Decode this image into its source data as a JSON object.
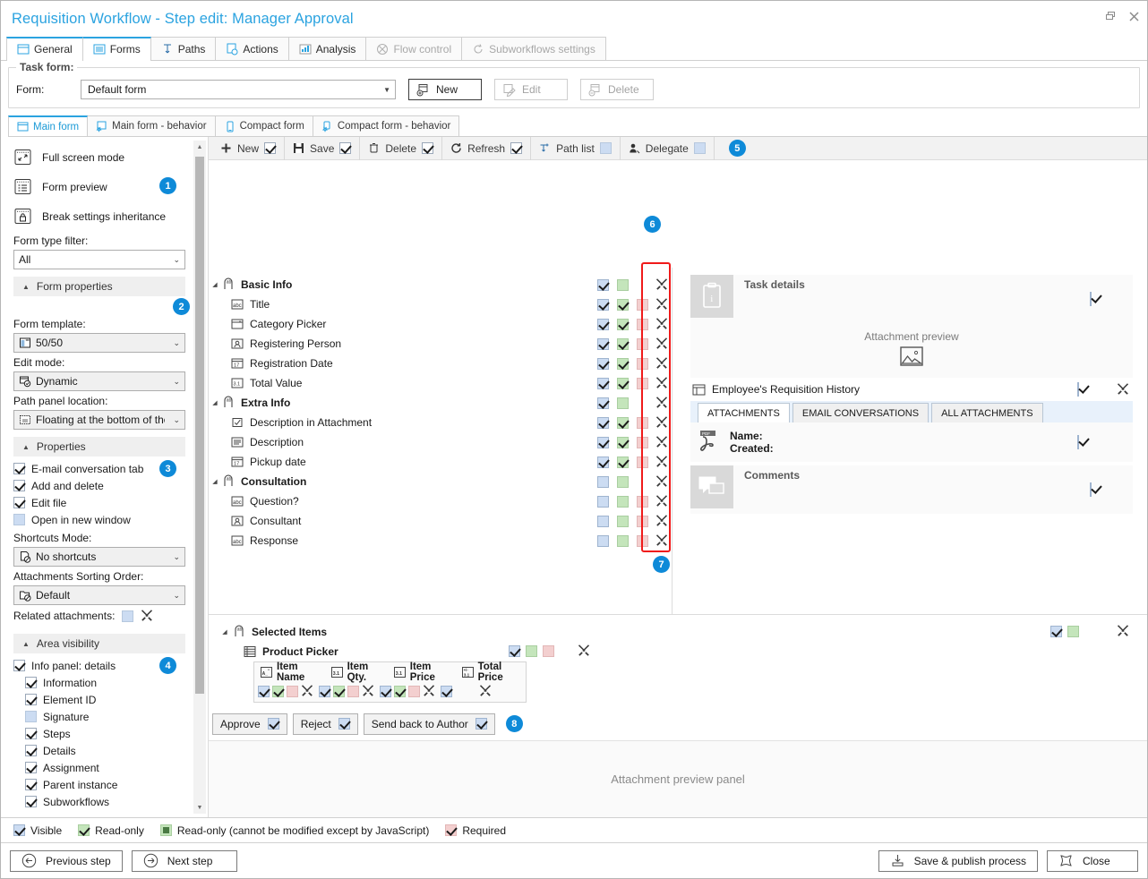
{
  "window": {
    "title": "Requisition Workflow - Step edit: Manager Approval",
    "restore_label": "❐",
    "close_label": "✕"
  },
  "main_tabs": [
    {
      "label": "General",
      "icon": "window-icon",
      "active": false,
      "disabled": false
    },
    {
      "label": "Forms",
      "icon": "list-form-icon",
      "active": true,
      "disabled": false
    },
    {
      "label": "Paths",
      "icon": "path-arrow-icon",
      "active": false,
      "disabled": false
    },
    {
      "label": "Actions",
      "icon": "action-page-icon",
      "active": false,
      "disabled": false
    },
    {
      "label": "Analysis",
      "icon": "chart-icon",
      "active": false,
      "disabled": false
    },
    {
      "label": "Flow control",
      "icon": "flow-control-icon",
      "active": false,
      "disabled": true
    },
    {
      "label": "Subworkflows settings",
      "icon": "subworkflow-icon",
      "active": false,
      "disabled": true
    }
  ],
  "task_form": {
    "legend": "Task form:",
    "form_label": "Form:",
    "form_value": "Default form",
    "new_label": "New",
    "edit_label": "Edit",
    "delete_label": "Delete"
  },
  "form_tabs": [
    {
      "label": "Main form",
      "icon": "main-form-icon",
      "active": true
    },
    {
      "label": "Main form - behavior",
      "icon": "main-form-behavior-icon",
      "active": false
    },
    {
      "label": "Compact form",
      "icon": "compact-form-icon",
      "active": false
    },
    {
      "label": "Compact form - behavior",
      "icon": "compact-form-behavior-icon",
      "active": false
    }
  ],
  "left_panel": {
    "actions": [
      {
        "label": "Full screen mode",
        "icon": "full-screen-icon"
      },
      {
        "label": "Form preview",
        "icon": "form-preview-icon"
      },
      {
        "label": "Break settings inheritance",
        "icon": "lock-inheritance-icon"
      }
    ],
    "form_type_filter_label": "Form type filter:",
    "form_type_filter_value": "All",
    "form_properties_header": "Form properties",
    "form_template_label": "Form template:",
    "form_template_value": "50/50",
    "edit_mode_label": "Edit mode:",
    "edit_mode_value": "Dynamic",
    "path_panel_label": "Path panel location:",
    "path_panel_value": "Floating at the bottom of the",
    "properties_header": "Properties",
    "properties": [
      {
        "label": "E-mail conversation tab",
        "checked": true
      },
      {
        "label": "Add and delete",
        "checked": true
      },
      {
        "label": "Edit file",
        "checked": true
      },
      {
        "label": "Open in new window",
        "checked": false
      }
    ],
    "shortcuts_mode_label": "Shortcuts Mode:",
    "shortcuts_mode_value": "No shortcuts",
    "attachments_sorting_label": "Attachments Sorting Order:",
    "attachments_sorting_value": "Default",
    "related_attachments_label": "Related attachments:",
    "area_visibility_header": "Area visibility",
    "area_visibility": [
      {
        "label": "Info panel: details",
        "checked": true,
        "indent": false
      },
      {
        "label": "Information",
        "checked": true,
        "indent": true
      },
      {
        "label": "Element ID",
        "checked": true,
        "indent": true
      },
      {
        "label": "Signature",
        "checked": false,
        "indent": true
      },
      {
        "label": "Steps",
        "checked": true,
        "indent": true
      },
      {
        "label": "Details",
        "checked": true,
        "indent": true
      },
      {
        "label": "Assignment",
        "checked": true,
        "indent": true
      },
      {
        "label": "Parent instance",
        "checked": true,
        "indent": true
      },
      {
        "label": "Subworkflows",
        "checked": true,
        "indent": true
      }
    ]
  },
  "preview_toolbar": [
    {
      "label": "New",
      "icon": "plus-icon",
      "state": "checked"
    },
    {
      "label": "Save",
      "icon": "save-icon",
      "state": "checked"
    },
    {
      "label": "Delete",
      "icon": "trash-icon",
      "state": "checked"
    },
    {
      "label": "Refresh",
      "icon": "refresh-icon",
      "state": "checked"
    },
    {
      "label": "Path list",
      "icon": "path-list-icon",
      "state": "blue"
    },
    {
      "label": "Delegate",
      "icon": "delegate-user-icon",
      "state": "blue"
    }
  ],
  "badges": {
    "b1": "1",
    "b2": "2",
    "b3": "3",
    "b4": "4",
    "b5": "5",
    "b6": "6",
    "b7": "7",
    "b8": "8"
  },
  "form_tree": [
    {
      "label": "Basic Info",
      "icon": "group-ab-icon",
      "level": 0,
      "group": true,
      "flags": [
        "check-blue",
        "green",
        "none",
        "tools"
      ]
    },
    {
      "label": "Title",
      "icon": "abc-text-icon",
      "level": 1,
      "group": false,
      "flags": [
        "check-blue",
        "check-green",
        "pink",
        "tools"
      ]
    },
    {
      "label": "Category Picker",
      "icon": "picker-icon",
      "level": 1,
      "group": false,
      "flags": [
        "check-blue",
        "check-green",
        "pink",
        "tools"
      ]
    },
    {
      "label": "Registering Person",
      "icon": "person-icon",
      "level": 1,
      "group": false,
      "flags": [
        "check-blue",
        "check-green",
        "pink",
        "tools"
      ]
    },
    {
      "label": "Registration Date",
      "icon": "calendar-17-icon",
      "level": 1,
      "group": false,
      "flags": [
        "check-blue",
        "check-green",
        "pink",
        "tools"
      ]
    },
    {
      "label": "Total Value",
      "icon": "number-31-icon",
      "level": 1,
      "group": false,
      "flags": [
        "check-blue",
        "check-green",
        "pink",
        "tools"
      ]
    },
    {
      "label": "Extra Info",
      "icon": "group-ab-icon",
      "level": 0,
      "group": true,
      "flags": [
        "check-blue",
        "green",
        "none",
        "tools"
      ]
    },
    {
      "label": "Description in Attachment",
      "icon": "checkbox-field-icon",
      "level": 1,
      "group": false,
      "flags": [
        "check-blue",
        "check-green",
        "pink",
        "tools"
      ]
    },
    {
      "label": "Description",
      "icon": "multiline-icon",
      "level": 1,
      "group": false,
      "flags": [
        "check-blue",
        "check-green",
        "pink",
        "tools"
      ]
    },
    {
      "label": "Pickup date",
      "icon": "calendar-17-icon",
      "level": 1,
      "group": false,
      "flags": [
        "check-blue",
        "check-green",
        "pink",
        "tools"
      ]
    },
    {
      "label": "Consultation",
      "icon": "group-ab-icon",
      "level": 0,
      "group": true,
      "flags": [
        "blue",
        "green",
        "none",
        "tools"
      ]
    },
    {
      "label": "Question?",
      "icon": "abc-text-icon",
      "level": 1,
      "group": false,
      "flags": [
        "blue",
        "green",
        "pink",
        "tools"
      ]
    },
    {
      "label": "Consultant",
      "icon": "person-icon",
      "level": 1,
      "group": false,
      "flags": [
        "blue",
        "green",
        "pink",
        "tools"
      ]
    },
    {
      "label": "Response",
      "icon": "abc-text-icon",
      "level": 1,
      "group": false,
      "flags": [
        "blue",
        "green",
        "pink",
        "tools"
      ]
    }
  ],
  "detail_panel": {
    "task_details_title": "Task details",
    "attachment_preview_label": "Attachment preview",
    "history_label": "Employee's Requisition History",
    "attachment_tabs": [
      {
        "label": "ATTACHMENTS",
        "active": true
      },
      {
        "label": "EMAIL CONVERSATIONS",
        "active": false
      },
      {
        "label": "ALL ATTACHMENTS",
        "active": false
      }
    ],
    "attachment_name_label": "Name:",
    "attachment_created_label": "Created:",
    "comments_title": "Comments"
  },
  "selected_items": {
    "group_label": "Selected Items",
    "picker_label": "Product Picker",
    "columns": [
      {
        "label": "Item Name",
        "icon": "text-column-icon"
      },
      {
        "label": "Item Qty.",
        "icon": "number-31-icon"
      },
      {
        "label": "Item Price",
        "icon": "number-31-icon"
      },
      {
        "label": "Total Price",
        "icon": "calc-column-icon"
      }
    ],
    "column_flags": [
      [
        "check-blue",
        "check-green",
        "pink",
        "tools"
      ],
      [
        "check-blue",
        "check-green",
        "pink",
        "tools"
      ],
      [
        "check-blue",
        "check-green",
        "pink",
        "tools"
      ],
      [
        "check-blue",
        "tools"
      ]
    ]
  },
  "path_buttons": [
    {
      "label": "Approve"
    },
    {
      "label": "Reject"
    },
    {
      "label": "Send back to Author"
    }
  ],
  "attachment_preview_panel_label": "Attachment preview panel",
  "legend": [
    {
      "label": "Visible",
      "kind": "check-blue"
    },
    {
      "label": "Read-only",
      "kind": "check-green"
    },
    {
      "label": "Read-only (cannot be modified except by JavaScript)",
      "kind": "green-solid"
    },
    {
      "label": "Required",
      "kind": "check-pink"
    }
  ],
  "footer": {
    "previous_step": "Previous step",
    "next_step": "Next step",
    "save_publish": "Save & publish process",
    "close": "Close"
  },
  "colors": {
    "title": "#2ba3e0",
    "badge": "#0e8ad8",
    "highlight_box": "#f01a1a",
    "visible_blue": "#ccdcf2",
    "readonly_green": "#c4e5bb",
    "required_pink": "#f3cfcf"
  }
}
